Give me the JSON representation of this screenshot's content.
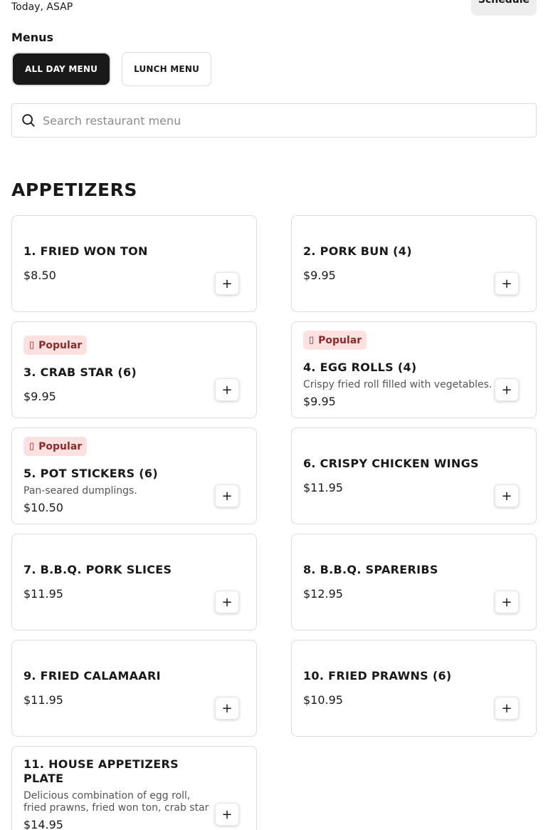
{
  "header": {
    "when": "Today, ASAP",
    "schedule_label": "Schedule"
  },
  "menus": {
    "label": "Menus",
    "tabs": [
      {
        "label": "ALL DAY MENU",
        "active": true
      },
      {
        "label": "LUNCH MENU",
        "active": false
      }
    ]
  },
  "search": {
    "placeholder": "Search restaurant menu",
    "value": ""
  },
  "section": {
    "title": "APPETIZERS",
    "items": [
      {
        "name": "1. FRIED WON TON",
        "price": "$8.50",
        "desc": "",
        "popular": false
      },
      {
        "name": "2. PORK BUN (4)",
        "price": "$9.95",
        "desc": "",
        "popular": false
      },
      {
        "name": "3. CRAB STAR (6)",
        "price": "$9.95",
        "desc": "",
        "popular": true
      },
      {
        "name": "4. EGG ROLLS (4)",
        "price": "$9.95",
        "desc": "Crispy fried roll filled with vegetables.",
        "popular": true
      },
      {
        "name": "5. POT STICKERS (6)",
        "price": "$10.50",
        "desc": "Pan-seared dumplings.",
        "popular": true
      },
      {
        "name": "6. CRISPY CHICKEN WINGS",
        "price": "$11.95",
        "desc": "",
        "popular": false
      },
      {
        "name": "7. B.B.Q. PORK SLICES",
        "price": "$11.95",
        "desc": "",
        "popular": false
      },
      {
        "name": "8. B.B.Q. SPARERIBS",
        "price": "$12.95",
        "desc": "",
        "popular": false
      },
      {
        "name": "9. FRIED CALAMAARI",
        "price": "$11.95",
        "desc": "",
        "popular": false
      },
      {
        "name": "10. FRIED PRAWNS (6)",
        "price": "$10.95",
        "desc": "",
        "popular": false
      },
      {
        "name": "11. HOUSE APPETIZERS PLATE",
        "price": "$14.95",
        "desc": "Delicious combination of egg roll, fried prawns, fried won ton, crab star",
        "popular": false
      }
    ]
  },
  "labels": {
    "popular": "Popular",
    "add_symbol": "+"
  },
  "icons": {
    "search": "search-icon",
    "popular": "trending-icon",
    "add": "plus-icon"
  }
}
